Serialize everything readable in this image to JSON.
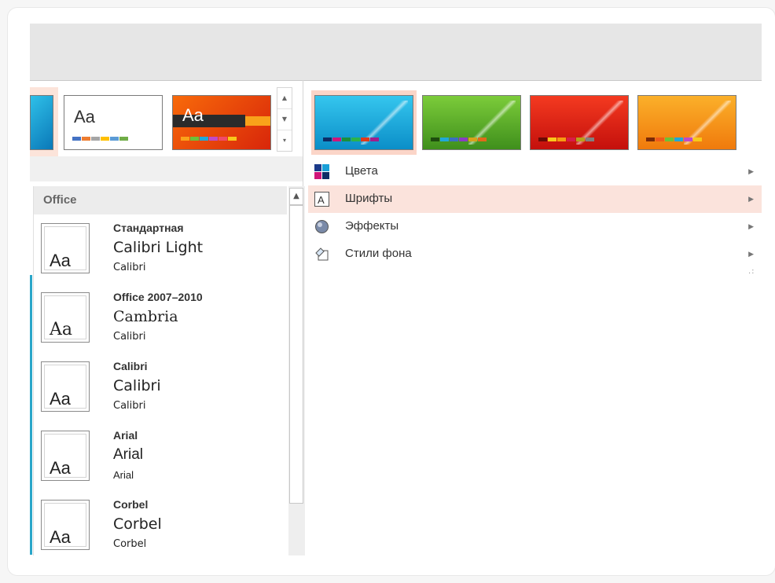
{
  "themes": {
    "thumb1_text": "Aa",
    "thumb2_text": "Aa"
  },
  "fonts_panel": {
    "header": "Office",
    "items": [
      {
        "thumb": "Aa",
        "name": "Стандартная",
        "heading": "Calibri Light",
        "body": "Calibri"
      },
      {
        "thumb": "Aa",
        "name": "Office 2007–2010",
        "heading": "Cambria",
        "body": "Calibri"
      },
      {
        "thumb": "Aa",
        "name": "Calibri",
        "heading": "Calibri",
        "body": "Calibri"
      },
      {
        "thumb": "Aa",
        "name": "Arial",
        "heading": "Arial",
        "body": "Arial"
      },
      {
        "thumb": "Aa",
        "name": "Corbel",
        "heading": "Corbel",
        "body": "Corbel"
      }
    ]
  },
  "variants_menu": {
    "items": [
      {
        "label": "Цвета",
        "icon": "colors-icon"
      },
      {
        "label": "Шрифты",
        "icon": "fonts-icon"
      },
      {
        "label": "Эффекты",
        "icon": "effects-icon"
      },
      {
        "label": "Стили фона",
        "icon": "background-styles-icon"
      }
    ]
  },
  "colors": {
    "accent_highlight": "#fbe3dc",
    "teal": "#2aa6c9",
    "variant_blue": "#1ba0d8",
    "variant_green": "#5aa82a",
    "variant_red": "#e01f14",
    "variant_orange": "#f59a12"
  }
}
